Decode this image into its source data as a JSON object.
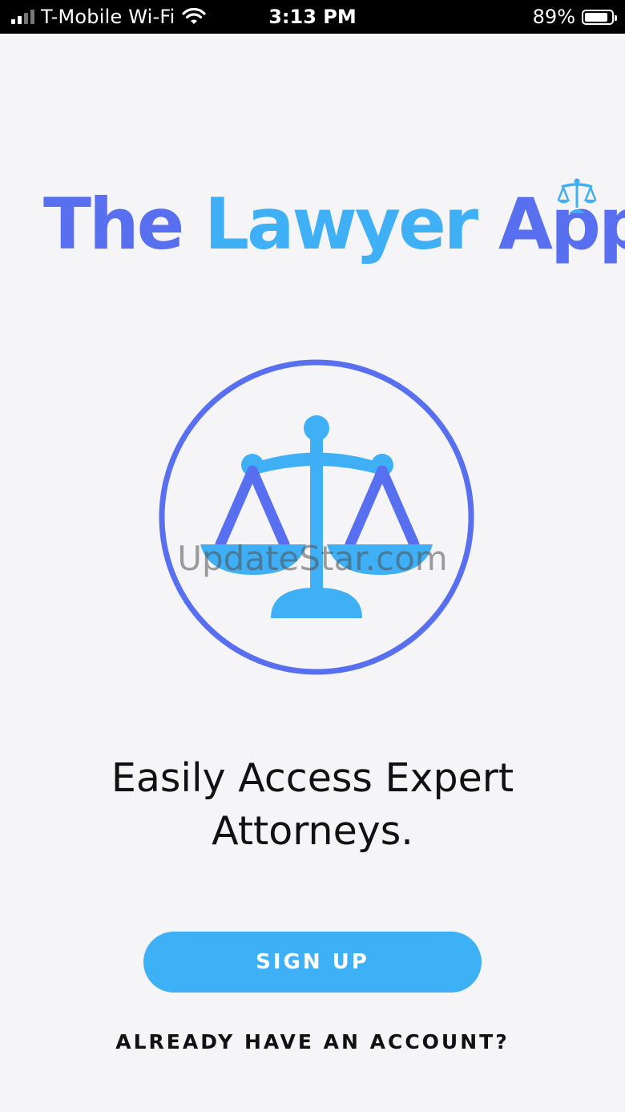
{
  "status_bar": {
    "carrier": "T-Mobile Wi-Fi",
    "time": "3:13 PM",
    "battery_percent": "89%",
    "battery_level": 0.89,
    "signal_icon": "cellular-signal-icon",
    "wifi_icon": "wifi-icon",
    "battery_icon": "battery-icon"
  },
  "logo": {
    "word1": "The",
    "word2": "Lawyer",
    "word3": "App",
    "icon": "scales-of-justice-icon"
  },
  "emblem": {
    "icon": "scales-of-justice-icon"
  },
  "watermark": "UpdateStar.com",
  "tagline": "Easily Access Expert Attorneys.",
  "actions": {
    "signup_label": "SIGN UP",
    "login_label": "ALREADY HAVE AN ACCOUNT?"
  },
  "colors": {
    "primary_blue": "#5870f0",
    "light_blue": "#3fb0f5",
    "background": "#f5f5f7"
  }
}
